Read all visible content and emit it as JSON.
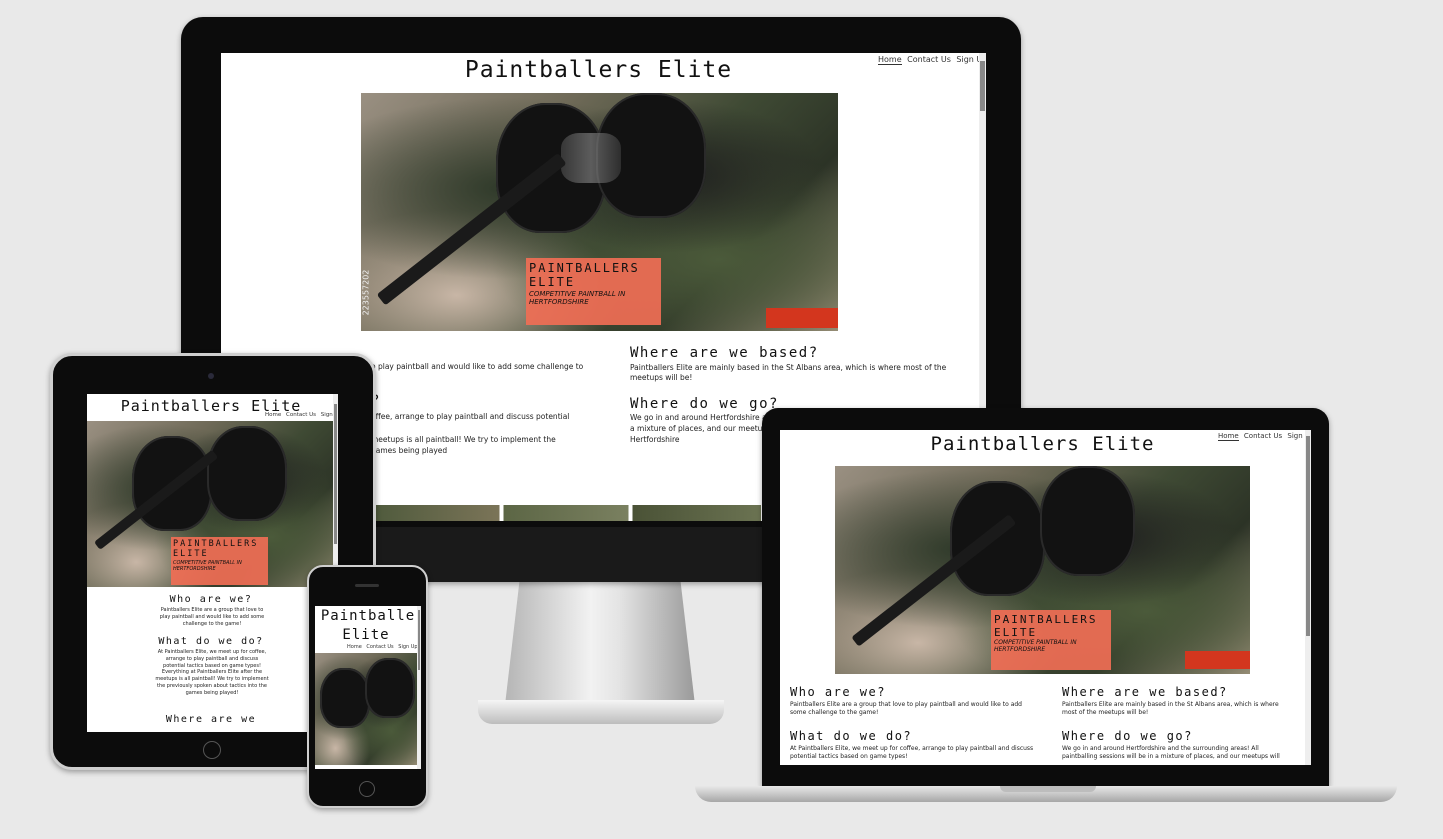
{
  "site": {
    "title": "Paintballers Elite",
    "tablet_title": "Paintballers Elite",
    "phone_title_1": "Paintballe",
    "phone_title_2": "Elite",
    "nav": [
      "Home",
      "Contact Us",
      "Sign Up"
    ],
    "hero_badge_title": "PAINTBALLERS ELITE",
    "hero_badge_title_1": "PAINTBALLERS",
    "hero_badge_title_2": "ELITE",
    "hero_badge_subtitle_1": "COMPETITIVE PAINTBALL IN",
    "hero_badge_subtitle_2": "HERTFORDSHIRE",
    "watermark": "223557202"
  },
  "sections": {
    "who": {
      "heading": "Who are we?",
      "desktop_partial": "o play paintball and would like to add some challenge to",
      "laptop_text": "Paintballers Elite are a group that love to play paintball and would like to add some challenge to the game!",
      "tablet_text": "Paintballers Elite are a group that love to play paintball and would like to add some challenge to the game!"
    },
    "what": {
      "heading": "What do we do?",
      "desktop_heading_partial": "?",
      "desktop_partial_1": "offee, arrange to play paintball and discuss potential",
      "desktop_partial_2": "meetups is all paintball! We try to implement the",
      "desktop_partial_3": "games being played",
      "laptop_text": "At Paintballers Elite, we meet up for coffee, arrange to play paintball and discuss potential tactics based on game types!",
      "tablet_text": "At Paintballers Elite, we meet up for coffee, arrange to play paintball and discuss potential tactics based on game types! Everything at Paintballers Elite after the meetups is all paintball! We try to implement the previously spoken about tactics into the games being played!"
    },
    "where_based": {
      "heading": "Where are we based?",
      "text": "Paintballers Elite are mainly based in the St Albans area, which is where most of the meetups will be!"
    },
    "where_go": {
      "heading": "Where do we go?",
      "desktop_text_1": "We go in and around Hertfordshire a",
      "desktop_text_2": "a mixture of places, and our meetup",
      "desktop_text_3": "Hertfordshire",
      "laptop_text": "We go in and around Hertfordshire and the surrounding areas! All paintballing sessions will be in a mixture of places, and our meetups will"
    },
    "tablet_next_heading": "Where are we"
  },
  "colors": {
    "background": "#e9e9e9",
    "bezel": "#0c0c0c",
    "badge": "#f06e55",
    "accent_red": "#d3361e"
  }
}
